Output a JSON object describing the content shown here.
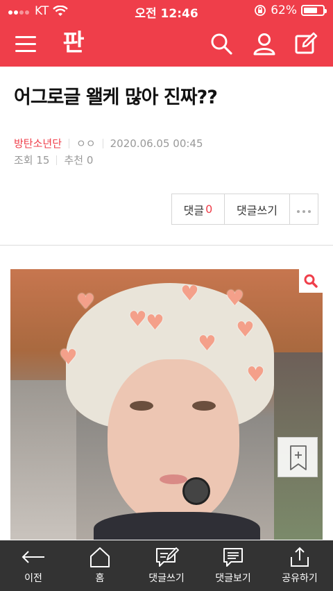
{
  "status_bar": {
    "carrier": "KT",
    "time": "오전 12:46",
    "battery": "62%",
    "battery_level": 0.62
  },
  "header": {
    "logo": "판",
    "icons": [
      "menu-icon",
      "search-icon",
      "user-icon",
      "write-icon"
    ]
  },
  "post": {
    "title": "어그로글 왤케 많아 진짜??",
    "category": "방탄소년단",
    "author": "ㅇㅇ",
    "datetime": "2020.06.05 00:45",
    "views_label": "조회 15",
    "recommend_label": "추천 0"
  },
  "actions": {
    "comments_label": "댓글",
    "comments_count": "0",
    "write_comment_label": "댓글쓰기"
  },
  "bottom_nav": {
    "back": "이전",
    "home": "홈",
    "write_comment": "댓글쓰기",
    "view_comments": "댓글보기",
    "share": "공유하기"
  },
  "colors": {
    "brand": "#ef3e4a",
    "bottom_bar": "#333333"
  }
}
